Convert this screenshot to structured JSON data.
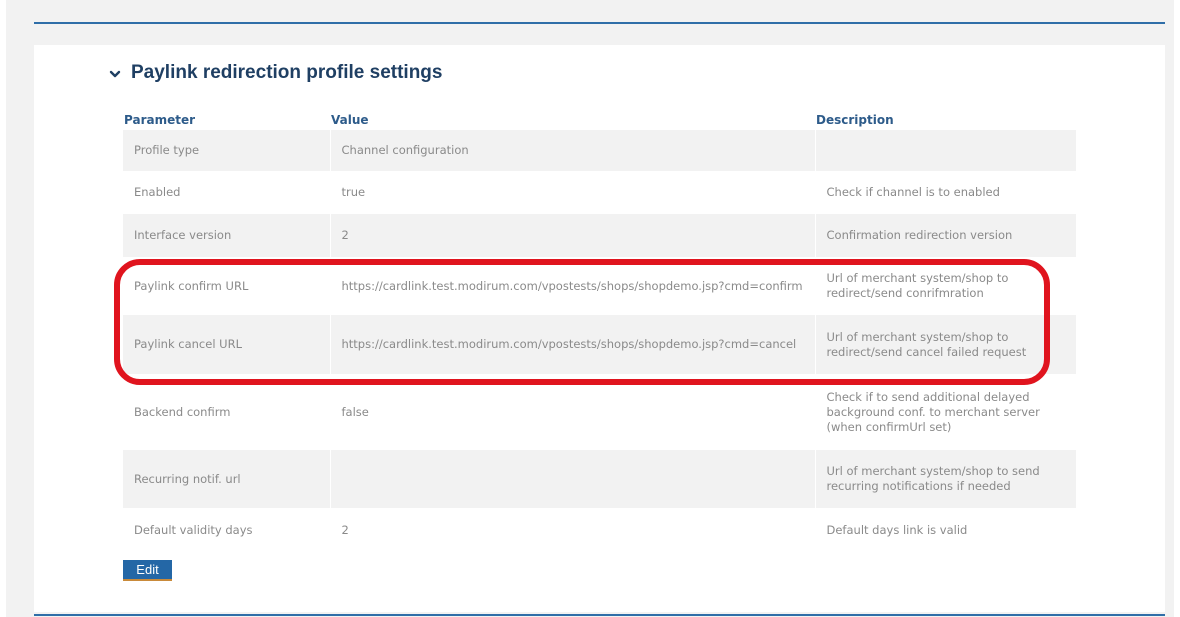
{
  "section": {
    "title": "Paylink redirection profile settings",
    "toggle_icon": "chevron-down-icon"
  },
  "table": {
    "headers": {
      "parameter": "Parameter",
      "value": "Value",
      "description": "Description"
    },
    "rows": [
      {
        "parameter": "Profile type",
        "value": "Channel configuration",
        "description": ""
      },
      {
        "parameter": "Enabled",
        "value": "true",
        "description": "Check if channel is to enabled"
      },
      {
        "parameter": "Interface version",
        "value": "2",
        "description": "Confirmation redirection version"
      },
      {
        "parameter": "Paylink confirm URL",
        "value": "https://cardlink.test.modirum.com/vpostests/shops/shopdemo.jsp?cmd=confirm",
        "description": "Url of merchant system/shop to redirect/send conrifmration"
      },
      {
        "parameter": "Paylink cancel URL",
        "value": "https://cardlink.test.modirum.com/vpostests/shops/shopdemo.jsp?cmd=cancel",
        "description": "Url of merchant system/shop to redirect/send cancel failed request"
      },
      {
        "parameter": "Backend confirm",
        "value": "false",
        "description": "Check if to send additional delayed background conf. to merchant server (when confirmUrl set)"
      },
      {
        "parameter": "Recurring notif. url",
        "value": "",
        "description": "Url of merchant system/shop to send recurring notifications if needed"
      },
      {
        "parameter": "Default validity days",
        "value": "2",
        "description": "Default days link is valid"
      }
    ]
  },
  "actions": {
    "edit_label": "Edit"
  },
  "colors": {
    "accent": "#2f6ea8",
    "highlight": "#e0141e",
    "button": "#2467a6"
  }
}
